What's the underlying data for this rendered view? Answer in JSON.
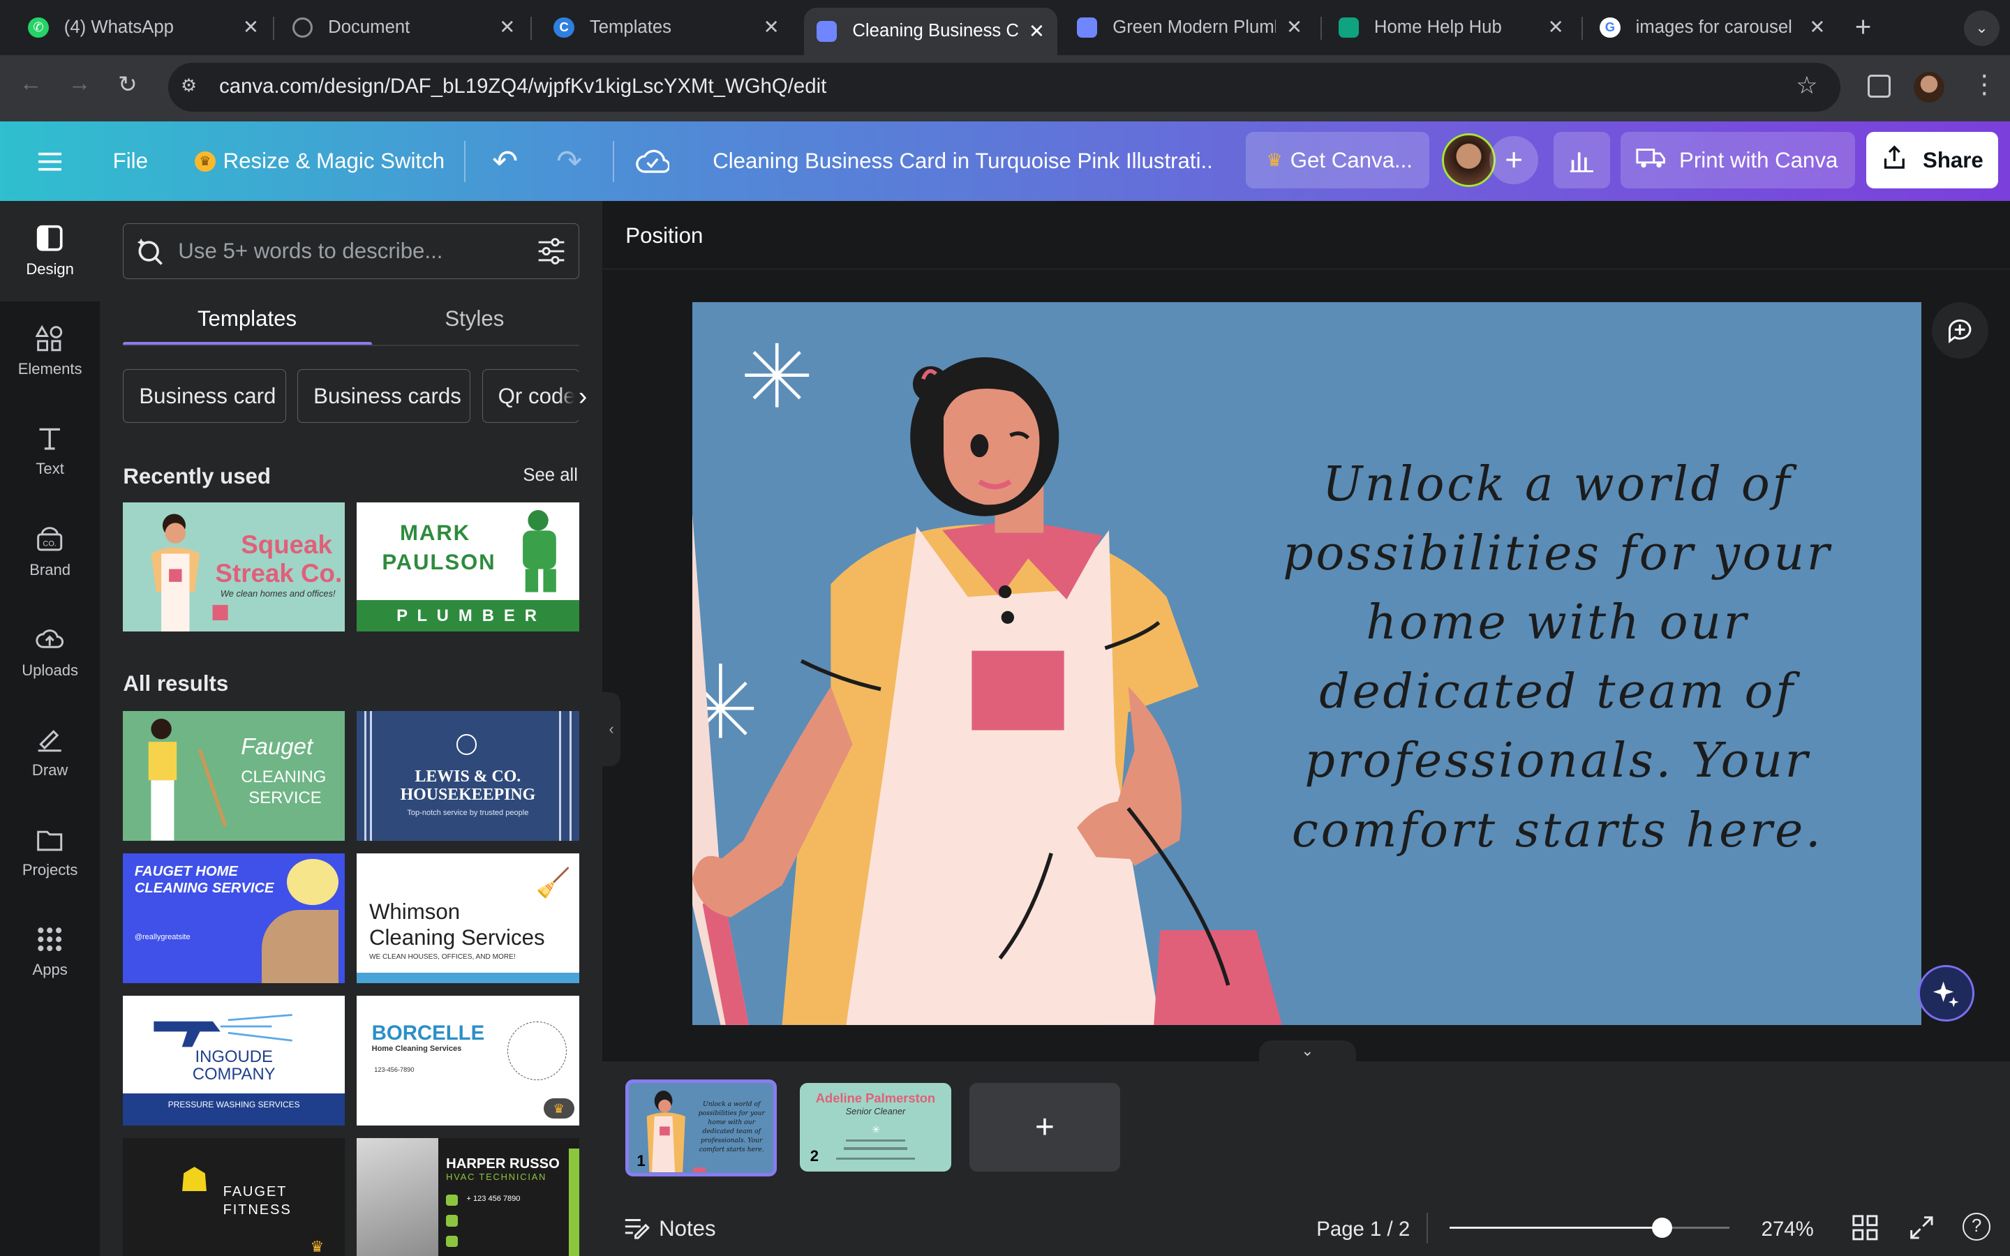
{
  "browser": {
    "tabs": [
      {
        "title": "(4) WhatsApp",
        "icon": "whatsapp-icon",
        "color": "#25d366"
      },
      {
        "title": "Document",
        "icon": "globe-icon",
        "color": "#8a8d91"
      },
      {
        "title": "Templates",
        "icon": "canva-icon",
        "color": "#2f7fe0"
      },
      {
        "title": "Cleaning Business C",
        "icon": "canva-doc-icon",
        "color": "#6f86ff"
      },
      {
        "title": "Green Modern Plumb",
        "icon": "canva-doc-icon",
        "color": "#6f86ff"
      },
      {
        "title": "Home Help Hub",
        "icon": "chatgpt-icon",
        "color": "#10a37f"
      },
      {
        "title": "images for carousel",
        "icon": "google-icon",
        "color": "#4285f4"
      }
    ],
    "url": "canva.com/design/DAF_bL19ZQ4/wjpfKv1kigLscYXMt_WGhQ/edit"
  },
  "header": {
    "file": "File",
    "resize": "Resize & Magic Switch",
    "title": "Cleaning Business Card in Turquoise Pink Illustrati...",
    "get_canva": "Get Canva...",
    "print": "Print with Canva",
    "share": "Share"
  },
  "rail": [
    {
      "label": "Design"
    },
    {
      "label": "Elements"
    },
    {
      "label": "Text"
    },
    {
      "label": "Brand"
    },
    {
      "label": "Uploads"
    },
    {
      "label": "Draw"
    },
    {
      "label": "Projects"
    },
    {
      "label": "Apps"
    }
  ],
  "panel": {
    "search_placeholder": "Use 5+ words to describe...",
    "tabs": [
      "Templates",
      "Styles"
    ],
    "chips": [
      "Business card",
      "Business cards",
      "Qr code"
    ],
    "recently_used": "Recently used",
    "see_all": "See all",
    "all_results": "All results",
    "recent": [
      {
        "line1": "Squeak",
        "line2": "Streak Co.",
        "sub": "We clean homes and offices!"
      },
      {
        "line1": "MARK",
        "line2": "PAULSON",
        "sub": "P L U M B E R"
      }
    ],
    "results": [
      {
        "line1": "Fauget",
        "line2": "CLEANING",
        "line3": "SERVICE"
      },
      {
        "line1": "LEWIS & CO.",
        "line2": "HOUSEKEEPING",
        "line3": "Top-notch service by trusted people"
      },
      {
        "line1": "FAUGET HOME",
        "line2": "CLEANING SERVICE",
        "line3": "@reallygreatsite"
      },
      {
        "line1": "Whimson",
        "line2": "Cleaning Services",
        "line3": "WE CLEAN HOUSES, OFFICES, AND MORE!"
      },
      {
        "line1": "INGOUDE",
        "line2": "COMPANY",
        "line3": "PRESSURE WASHING SERVICES"
      },
      {
        "line1": "BORCELLE",
        "line2": "Home Cleaning Services",
        "line3": "123-456-7890"
      },
      {
        "line1": "FAUGET",
        "line2": "FITNESS",
        "line3": ""
      },
      {
        "line1": "HARPER RUSSO",
        "line2": "HVAC TECHNICIAN",
        "line3": "+ 123 456 7890"
      }
    ]
  },
  "editor": {
    "position": "Position",
    "quote": "Unlock a world of possibilities for your home with our dedicated team of professionals. Your comfort starts here."
  },
  "pages": {
    "p1": "1",
    "p2": "2",
    "p2_name": "Adeline Palmerston",
    "p2_role": "Senior Cleaner",
    "add": "+"
  },
  "footer": {
    "notes": "Notes",
    "page": "Page 1 / 2",
    "zoom": "274%",
    "zoom_level": 0.76
  }
}
